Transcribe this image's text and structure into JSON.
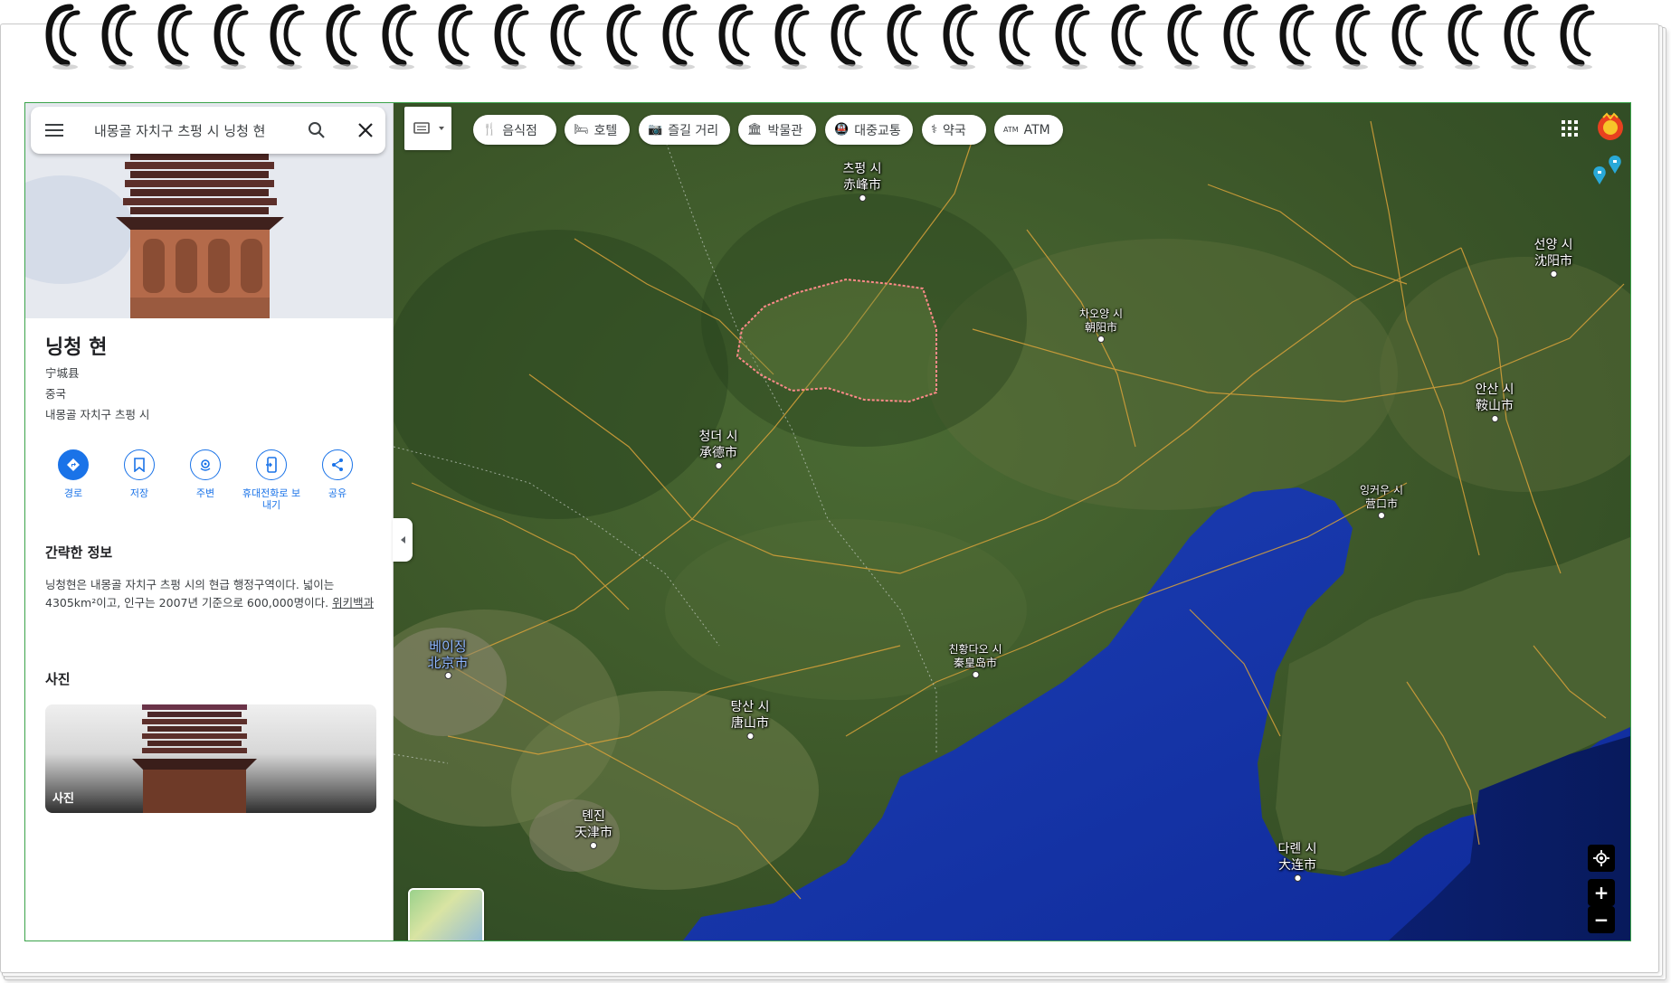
{
  "search": {
    "query": "내몽골 자치구 츠펑 시 닝청 현"
  },
  "place": {
    "title": "닝청 현",
    "native_name": "宁城县",
    "country": "중국",
    "region": "내몽골 자치구 츠펑 시"
  },
  "actions": [
    {
      "label": "경로"
    },
    {
      "label": "저장"
    },
    {
      "label": "주변"
    },
    {
      "label": "휴대전화로 보내기"
    },
    {
      "label": "공유"
    }
  ],
  "summary": {
    "title": "간략한 정보",
    "text": "닝청현은 내몽골 자치구 츠펑 시의 현급 행정구역이다. 넓이는 4305km²이고, 인구는 2007년 기준으로 600,000명이다.",
    "source_link": "위키백과"
  },
  "photos": {
    "title": "사진",
    "thumb_label": "사진"
  },
  "chips": [
    {
      "icon": "restaurant-icon",
      "label": "음식점"
    },
    {
      "icon": "hotel-icon",
      "label": "호텔"
    },
    {
      "icon": "camera-icon",
      "label": "즐길 거리"
    },
    {
      "icon": "museum-icon",
      "label": "박물관"
    },
    {
      "icon": "transit-icon",
      "label": "대중교통"
    },
    {
      "icon": "pharmacy-icon",
      "label": "약국"
    },
    {
      "icon": "atm-icon",
      "label": "ATM"
    }
  ],
  "cities": [
    {
      "ko": "츠펑 시",
      "zh": "赤峰市"
    },
    {
      "ko": "선양 시",
      "zh": "沈阳市"
    },
    {
      "ko": "차오양 시",
      "zh": "朝阳市"
    },
    {
      "ko": "안산 시",
      "zh": "鞍山市"
    },
    {
      "ko": "청더 시",
      "zh": "承德市"
    },
    {
      "ko": "잉커우 시",
      "zh": "营口市"
    },
    {
      "ko": "베이징",
      "zh": "北京市"
    },
    {
      "ko": "친황다오 시",
      "zh": "秦皇岛市"
    },
    {
      "ko": "탕산 시",
      "zh": "唐山市"
    },
    {
      "ko": "톈진",
      "zh": "天津市"
    },
    {
      "ko": "다롄 시",
      "zh": "大连市"
    }
  ],
  "colors": {
    "accent": "#1a73e8",
    "sea": "#1f3fb8",
    "land": "#3d5a2a",
    "boundary": "#ff8a8a",
    "frame": "#3aa34a"
  }
}
